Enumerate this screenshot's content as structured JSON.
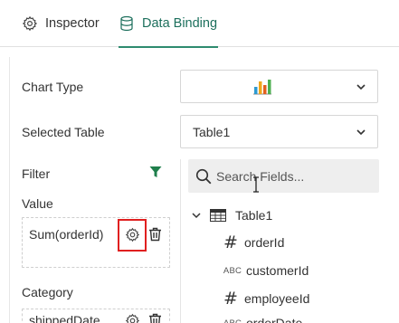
{
  "tabs": [
    {
      "label": "Inspector",
      "icon": "gear-icon",
      "active": false
    },
    {
      "label": "Data Binding",
      "icon": "database-icon",
      "active": true
    }
  ],
  "chart_type": {
    "label": "Chart Type",
    "value_icon": "bar-chart-icon",
    "colors": [
      "#2e9ad0",
      "#f0a81c",
      "#e2611f",
      "#4caf50"
    ]
  },
  "selected_table": {
    "label": "Selected Table",
    "value": "Table1"
  },
  "filter": {
    "label": "Filter",
    "icon": "funnel-icon",
    "color": "#1f7f4c"
  },
  "value_section": {
    "label": "Value",
    "field": "Sum(orderId)"
  },
  "category_section": {
    "label": "Category",
    "field": "shippedDate"
  },
  "search": {
    "placeholder": "Search Fields..."
  },
  "tree": {
    "table": "Table1",
    "fields": [
      {
        "name": "orderId",
        "type_icon": "#"
      },
      {
        "name": "customerId",
        "type_icon": "ABC"
      },
      {
        "name": "employeeId",
        "type_icon": "#"
      },
      {
        "name": "orderDate",
        "type_icon": "ABC"
      }
    ]
  },
  "accent": "#2e8b6f",
  "highlight_color": "#e02020"
}
